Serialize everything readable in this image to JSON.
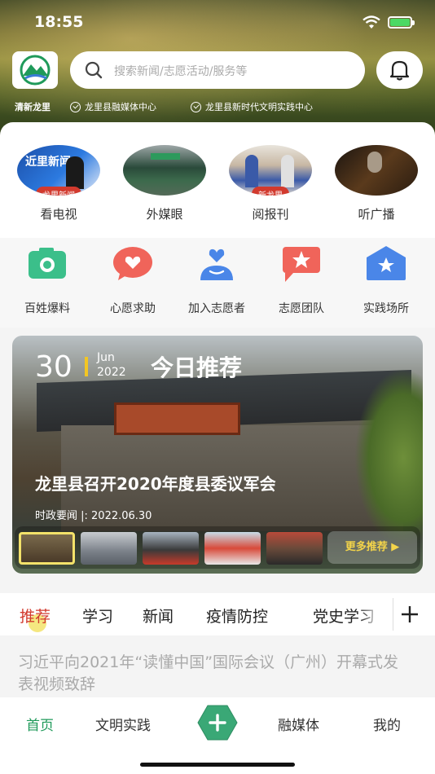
{
  "status_bar": {
    "time": "18:55"
  },
  "header": {
    "search_placeholder": "搜索新闻/志愿活动/服务等",
    "org_main": "清新龙里",
    "orgs": [
      "龙里县融媒体中心",
      "龙里县新时代文明实践中心"
    ]
  },
  "media": [
    {
      "label": "看电视",
      "tag": "龙里新闻"
    },
    {
      "label": "外媒眼",
      "tag": ""
    },
    {
      "label": "阅报刊",
      "tag": "新龙里"
    },
    {
      "label": "听广播",
      "tag": ""
    }
  ],
  "services": [
    {
      "label": "百姓爆料",
      "icon": "camera-icon",
      "color": "#3bbf8a"
    },
    {
      "label": "心愿求助",
      "icon": "heart-bubble-icon",
      "color": "#f0645a"
    },
    {
      "label": "加入志愿者",
      "icon": "volunteer-icon",
      "color": "#4a86e8"
    },
    {
      "label": "志愿团队",
      "icon": "star-flag-icon",
      "color": "#f0645a"
    },
    {
      "label": "实践场所",
      "icon": "star-house-icon",
      "color": "#4a86e8"
    }
  ],
  "feature": {
    "day": "30",
    "month": "Jun",
    "year": "2022",
    "title": "今日推荐",
    "headline": "龙里县召开2020年度县委议军会",
    "meta": "时政要闻 |:  2022.06.30",
    "more_label": "更多推荐  ▶"
  },
  "tabs": [
    "推荐",
    "学习",
    "新闻",
    "疫情防控",
    "党史学习"
  ],
  "active_tab": "推荐",
  "news_title": "习近平向2021年“读懂中国”国际会议（广州）开幕式发表视频致辞",
  "bottom_nav": [
    "首页",
    "文明实践",
    "融媒体",
    "我的"
  ],
  "colors": {
    "accent_green": "#1f9a5a",
    "accent_red": "#d23a2e",
    "highlight_yellow": "#f3c623"
  }
}
